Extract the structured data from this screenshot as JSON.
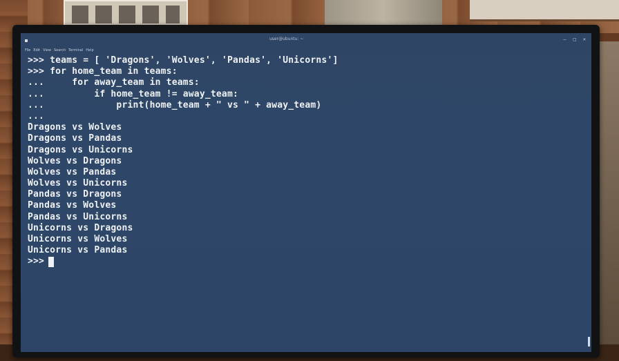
{
  "window": {
    "title": "user@ubuntu: ~",
    "controls": {
      "minimize": "–",
      "maximize": "□",
      "close": "✕"
    }
  },
  "menubar": [
    "File",
    "Edit",
    "View",
    "Search",
    "Terminal",
    "Help"
  ],
  "terminal": {
    "lines": [
      ">>> teams = [ 'Dragons', 'Wolves', 'Pandas', 'Unicorns']",
      ">>> for home_team in teams:",
      "...     for away_team in teams:",
      "...         if home_team != away_team:",
      "...             print(home_team + \" vs \" + away_team)",
      "...",
      "Dragons vs Wolves",
      "Dragons vs Pandas",
      "Dragons vs Unicorns",
      "Wolves vs Dragons",
      "Wolves vs Pandas",
      "Wolves vs Unicorns",
      "Pandas vs Dragons",
      "Pandas vs Wolves",
      "Pandas vs Unicorns",
      "Unicorns vs Dragons",
      "Unicorns vs Wolves",
      "Unicorns vs Pandas"
    ],
    "prompt": ">>>"
  },
  "colors": {
    "terminal_bg": "#2e4769",
    "terminal_fg": "#eef2f7"
  },
  "icons": {
    "window_menu": "menu-square-icon",
    "cursor": "block-cursor-icon"
  }
}
